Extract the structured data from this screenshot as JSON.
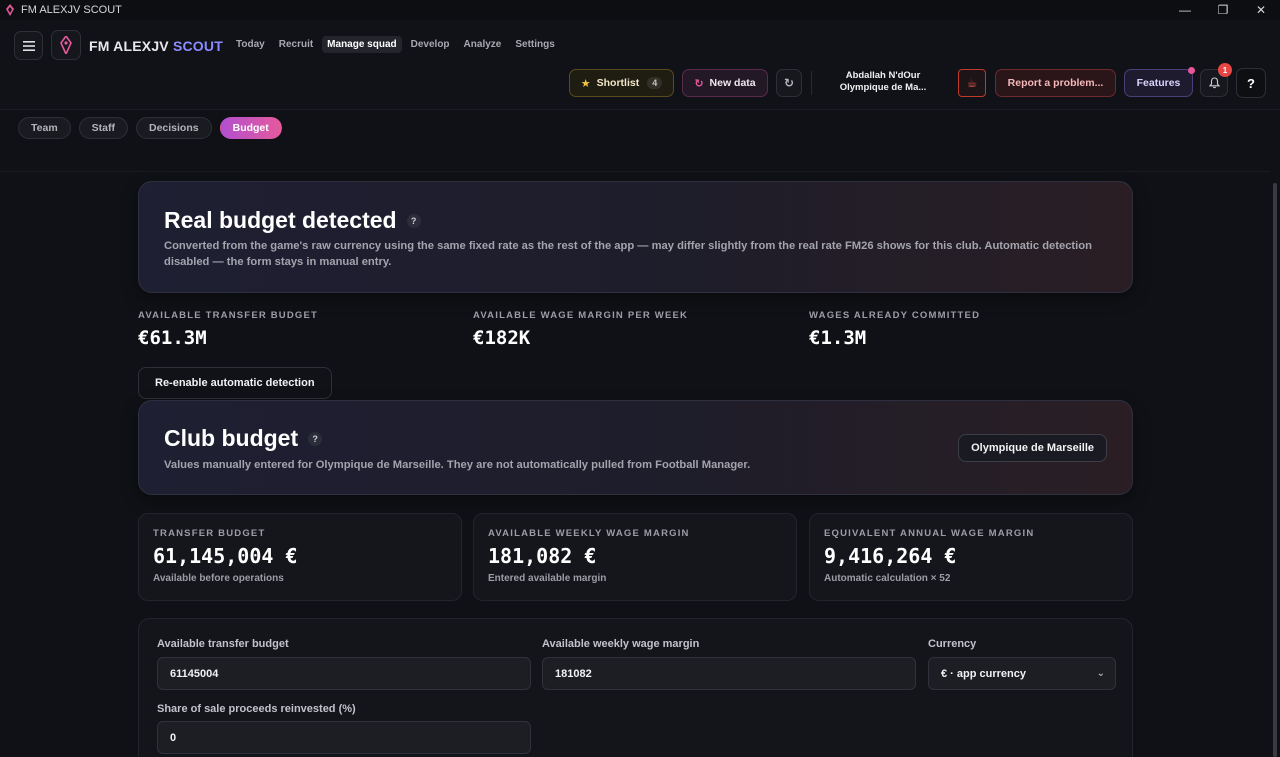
{
  "window": {
    "title": "FM ALEXJV SCOUT",
    "controls": [
      "minimize",
      "restore",
      "close"
    ]
  },
  "brand": {
    "name_main": "FM ALEXJV",
    "name_accent": "SCOUT"
  },
  "nav": {
    "items": [
      {
        "label": "Today",
        "active": false
      },
      {
        "label": "Recruit",
        "active": false
      },
      {
        "label": "Manage squad",
        "active": true
      },
      {
        "label": "Develop",
        "active": false
      },
      {
        "label": "Analyze",
        "active": false
      },
      {
        "label": "Settings",
        "active": false
      }
    ]
  },
  "actions": {
    "shortlist_label": "Shortlist",
    "shortlist_count": "4",
    "new_data_label": "New data",
    "player_name": "Abdallah N'dOur",
    "player_club": "Olympique de Ma...",
    "report_label": "Report a problem...",
    "features_label": "Features",
    "notifications_count": "1",
    "help_label": "?"
  },
  "subtabs": [
    {
      "label": "Team",
      "active": false
    },
    {
      "label": "Staff",
      "active": false
    },
    {
      "label": "Decisions",
      "active": false
    },
    {
      "label": "Budget",
      "active": true
    }
  ],
  "real_budget": {
    "title": "Real budget detected",
    "help": "?",
    "description": "Converted from the game's raw currency using the same fixed rate as the rest of the app — may differ slightly from the real rate FM26 shows for this club. Automatic detection disabled — the form stays in manual entry."
  },
  "detected_stats": [
    {
      "label": "AVAILABLE TRANSFER BUDGET",
      "value": "€61.3M"
    },
    {
      "label": "AVAILABLE WAGE MARGIN PER WEEK",
      "value": "€182K"
    },
    {
      "label": "WAGES ALREADY COMMITTED",
      "value": "€1.3M"
    }
  ],
  "reenable_label": "Re-enable automatic detection",
  "club_budget": {
    "title": "Club budget",
    "help": "?",
    "description": "Values manually entered for Olympique de Marseille. They are not automatically pulled from Football Manager.",
    "club_button": "Olympique de Marseille"
  },
  "metrics": [
    {
      "label": "TRANSFER BUDGET",
      "value": "61,145,004 €",
      "sub": "Available before operations"
    },
    {
      "label": "AVAILABLE WEEKLY WAGE MARGIN",
      "value": "181,082 €",
      "sub": "Entered available margin"
    },
    {
      "label": "EQUIVALENT ANNUAL WAGE MARGIN",
      "value": "9,416,264 €",
      "sub": "Automatic calculation × 52"
    }
  ],
  "form": {
    "transfer_label": "Available transfer budget",
    "transfer_value": "61145004",
    "wage_label": "Available weekly wage margin",
    "wage_value": "181082",
    "currency_label": "Currency",
    "currency_value": "€ · app currency",
    "reinvest_label": "Share of sale proceeds reinvested (%)",
    "reinvest_value": "0"
  },
  "colors": {
    "accent": "#8a8cff",
    "budget_tab_gradient": [
      "#b24fd0",
      "#e45a9c"
    ],
    "badge": "#e84545"
  }
}
